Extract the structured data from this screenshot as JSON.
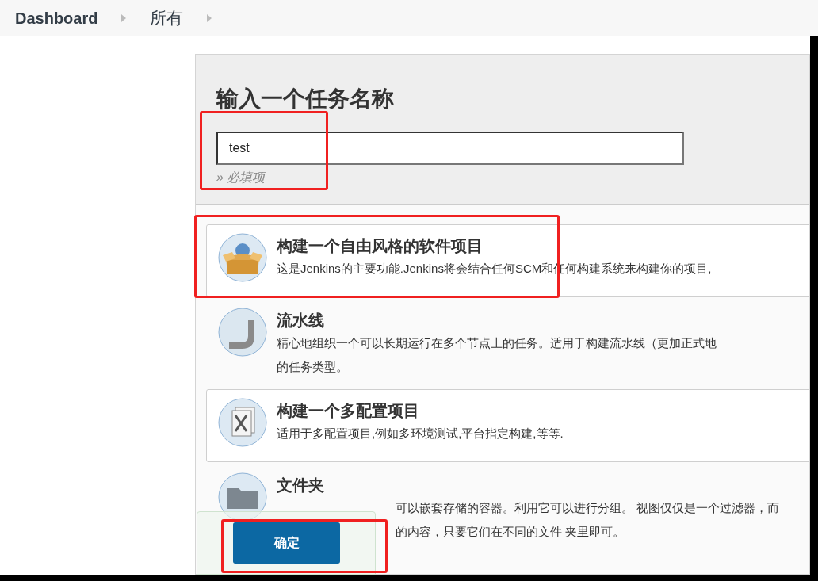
{
  "breadcrumb": [
    {
      "label": "Dashboard"
    },
    {
      "label": "所有"
    }
  ],
  "form": {
    "heading": "输入一个任务名称",
    "name_value": "test",
    "hint": "» 必填项"
  },
  "items": [
    {
      "kind": "box",
      "selected": true,
      "title": "构建一个自由风格的软件项目",
      "lines": [
        "这是Jenkins的主要功能.Jenkins将会结合任何SCM和任何构建系统来构建你的项目,"
      ]
    },
    {
      "kind": "pipe",
      "selected": false,
      "title": "流水线",
      "lines": [
        "精心地组织一个可以长期运行在多个节点上的任务。适用于构建流水线（更加正式地",
        "的任务类型。"
      ]
    },
    {
      "kind": "config",
      "selected": true,
      "title": "构建一个多配置项目",
      "lines": [
        "适用于多配置项目,例如多环境测试,平台指定构建,等等."
      ]
    },
    {
      "kind": "folder",
      "selected": false,
      "title": "文件夹",
      "lines": [
        "可以嵌套存储的容器。利用它可以进行分组。 视图仅仅是一个过滤器，而",
        "的内容，只要它们在不同的文件 夹里即可。"
      ]
    }
  ],
  "footer": {
    "ok_button": "确定"
  }
}
